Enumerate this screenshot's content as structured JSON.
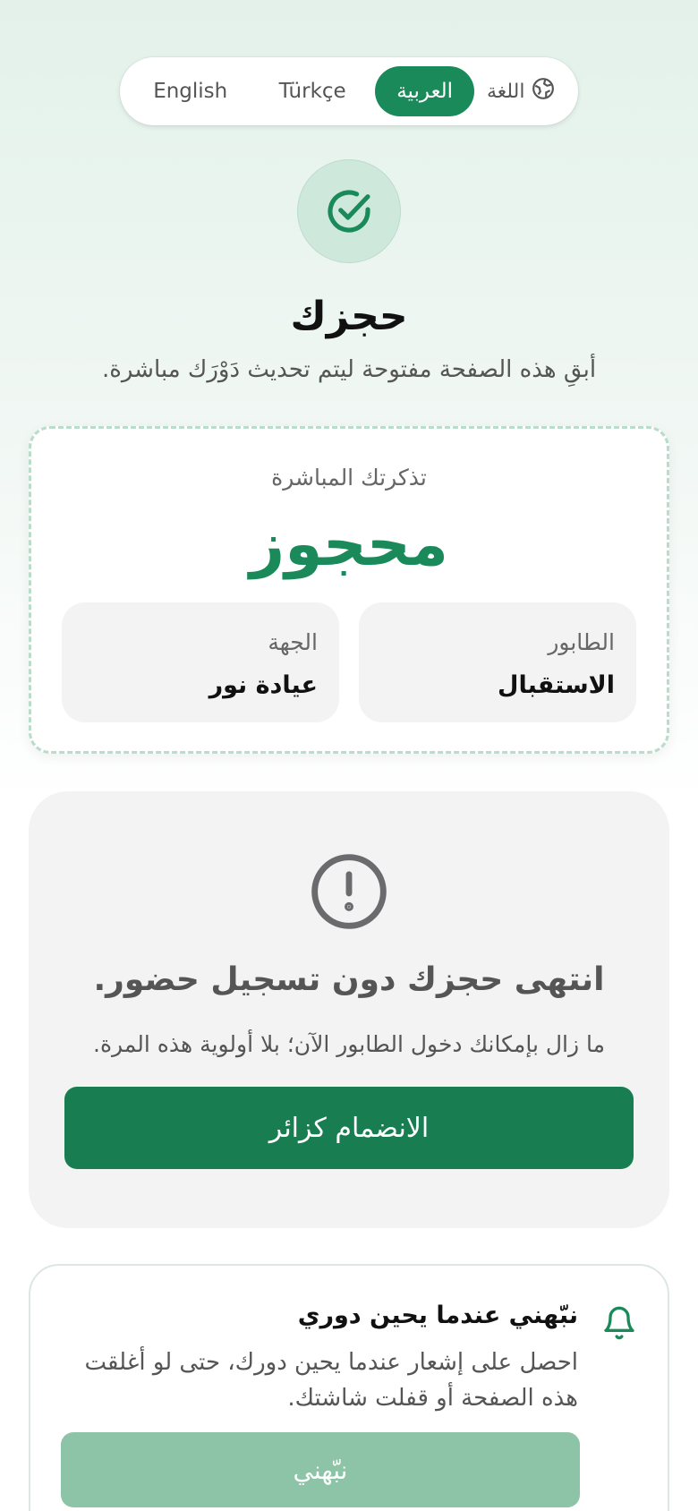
{
  "language_switcher": {
    "label": "اللغة",
    "options": [
      "العربية",
      "Türkçe",
      "English"
    ],
    "active": "العربية"
  },
  "header": {
    "title": "حجزك",
    "subtitle": "أبقِ هذه الصفحة مفتوحة ليتم تحديث دَوْرَك مباشرة."
  },
  "ticket": {
    "label": "تذكرتك المباشرة",
    "status": "محجوز",
    "queue_label": "الطابور",
    "queue_value": "الاستقبال",
    "provider_label": "الجهة",
    "provider_value": "عيادة نور"
  },
  "expired": {
    "title": "انتهى حجزك دون تسجيل حضور.",
    "text": "ما زال بإمكانك دخول الطابور الآن؛ بلا أولوية هذه المرة.",
    "button": "الانضمام كزائر"
  },
  "notify": {
    "title": "نبّهني عندما يحين دوري",
    "text": "احصل على إشعار عندما يحين دورك، حتى لو أغلقت هذه الصفحة أو قفلت شاشتك.",
    "button": "نبّهني"
  },
  "colors": {
    "primary": "#1b8a5a",
    "primary_dark": "#187e52",
    "primary_disabled": "#8dc3a7",
    "muted_bg": "#f3f3f4"
  },
  "icons": {
    "language": "globe-icon",
    "success": "check-circle-icon",
    "alert": "alert-circle-icon",
    "bell": "bell-icon"
  }
}
